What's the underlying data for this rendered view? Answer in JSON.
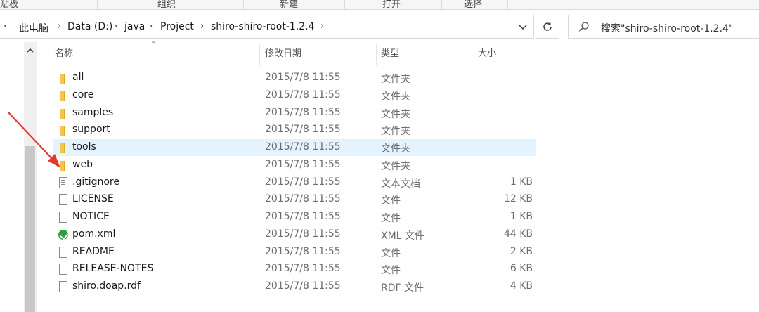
{
  "ribbon": {
    "groups": [
      "贴板",
      "组织",
      "新建",
      "打开",
      "选择"
    ]
  },
  "address": {
    "breadcrumb": [
      "此电脑",
      "Data (D:)",
      "java",
      "Project",
      "shiro-shiro-root-1.2.4"
    ],
    "separator": "›"
  },
  "search": {
    "placeholder": "搜索\"shiro-shiro-root-1.2.4\""
  },
  "columns": {
    "name": "名称",
    "modified": "修改日期",
    "type": "类型",
    "size": "大小"
  },
  "files": [
    {
      "name": "all",
      "modified": "2015/7/8 11:55",
      "type": "文件夹",
      "size": "",
      "icon": "folder-icon"
    },
    {
      "name": "core",
      "modified": "2015/7/8 11:55",
      "type": "文件夹",
      "size": "",
      "icon": "folder-icon"
    },
    {
      "name": "samples",
      "modified": "2015/7/8 11:55",
      "type": "文件夹",
      "size": "",
      "icon": "folder-icon"
    },
    {
      "name": "support",
      "modified": "2015/7/8 11:55",
      "type": "文件夹",
      "size": "",
      "icon": "folder-icon"
    },
    {
      "name": "tools",
      "modified": "2015/7/8 11:55",
      "type": "文件夹",
      "size": "",
      "icon": "folder-icon",
      "hovered": true
    },
    {
      "name": "web",
      "modified": "2015/7/8 11:55",
      "type": "文件夹",
      "size": "",
      "icon": "folder-icon"
    },
    {
      "name": ".gitignore",
      "modified": "2015/7/8 11:55",
      "type": "文本文档",
      "size": "1 KB",
      "icon": "text-file-icon"
    },
    {
      "name": "LICENSE",
      "modified": "2015/7/8 11:55",
      "type": "文件",
      "size": "12 KB",
      "icon": "file-icon"
    },
    {
      "name": "NOTICE",
      "modified": "2015/7/8 11:55",
      "type": "文件",
      "size": "1 KB",
      "icon": "file-icon"
    },
    {
      "name": "pom.xml",
      "modified": "2015/7/8 11:55",
      "type": "XML 文件",
      "size": "44 KB",
      "icon": "xml-file-icon"
    },
    {
      "name": "README",
      "modified": "2015/7/8 11:55",
      "type": "文件",
      "size": "2 KB",
      "icon": "file-icon"
    },
    {
      "name": "RELEASE-NOTES",
      "modified": "2015/7/8 11:55",
      "type": "文件",
      "size": "6 KB",
      "icon": "file-icon"
    },
    {
      "name": "shiro.doap.rdf",
      "modified": "2015/7/8 11:55",
      "type": "RDF 文件",
      "size": "4 KB",
      "icon": "file-icon"
    }
  ],
  "colors": {
    "folder": "#f4c64e",
    "hover_row": "#e5f3ff",
    "annotation_arrow": "#e8382e",
    "xml_icon": "#2f9e43"
  }
}
